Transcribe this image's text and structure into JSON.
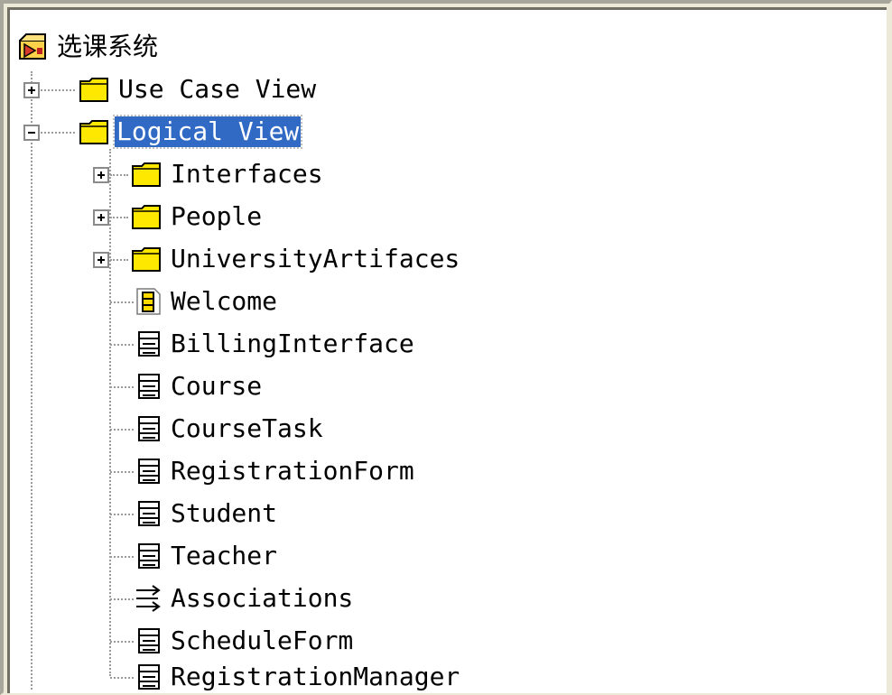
{
  "root": {
    "label": "选课系统",
    "icon": "rose-model-icon"
  },
  "nodes": [
    {
      "label": "Use Case View",
      "icon": "folder-icon",
      "expander": "plus"
    },
    {
      "label": "Logical View",
      "icon": "folder-icon",
      "expander": "minus",
      "selected": true
    },
    {
      "label": "Interfaces",
      "icon": "folder-icon",
      "expander": "plus"
    },
    {
      "label": "People",
      "icon": "folder-icon",
      "expander": "plus"
    },
    {
      "label": "UniversityArtifaces",
      "icon": "folder-icon",
      "expander": "plus"
    },
    {
      "label": "Welcome",
      "icon": "class-diagram-icon"
    },
    {
      "label": "BillingInterface",
      "icon": "class-diagram-icon"
    },
    {
      "label": "Course",
      "icon": "class-diagram-icon"
    },
    {
      "label": "CourseTask",
      "icon": "class-diagram-icon"
    },
    {
      "label": "RegistrationForm",
      "icon": "class-diagram-icon"
    },
    {
      "label": "Student",
      "icon": "class-diagram-icon"
    },
    {
      "label": "Teacher",
      "icon": "class-diagram-icon"
    },
    {
      "label": "Associations",
      "icon": "associations-icon"
    },
    {
      "label": "ScheduleForm",
      "icon": "class-diagram-icon"
    },
    {
      "label": "RegistrationManager",
      "icon": "class-diagram-icon"
    }
  ],
  "colors": {
    "selection": "#316ac5",
    "folder": "#ffe800",
    "diagram_highlight": "#ffd800"
  }
}
